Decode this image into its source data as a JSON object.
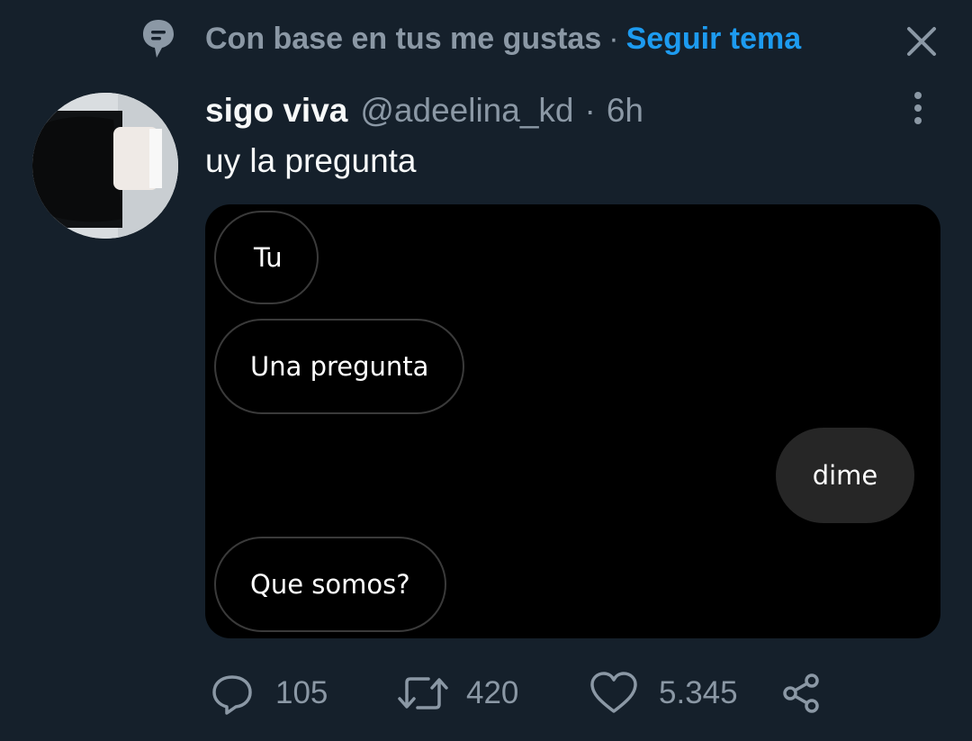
{
  "context": {
    "icon": "topic-icon",
    "text": "Con base en tus me gustas",
    "separator": "·",
    "follow_topic_label": "Seguir tema",
    "close_icon": "close-icon"
  },
  "tweet": {
    "display_name": "sigo viva",
    "handle": "@adeelina_kd",
    "separator": "·",
    "time": "6h",
    "text": "uy la pregunta",
    "more_icon": "more-vertical-icon"
  },
  "media": {
    "messages": [
      {
        "text": "Tu",
        "side": "received"
      },
      {
        "text": "Una pregunta",
        "side": "received"
      },
      {
        "text": "dime",
        "side": "sent"
      },
      {
        "text": "Que somos?",
        "side": "received"
      }
    ]
  },
  "actions": {
    "reply_count": "105",
    "retweet_count": "420",
    "like_count": "5.345",
    "reply_icon": "reply-icon",
    "retweet_icon": "retweet-icon",
    "like_icon": "heart-icon",
    "share_icon": "share-icon"
  },
  "colors": {
    "background": "#15202b",
    "accent": "#1d9bf0",
    "secondary_text": "#8b98a5"
  }
}
